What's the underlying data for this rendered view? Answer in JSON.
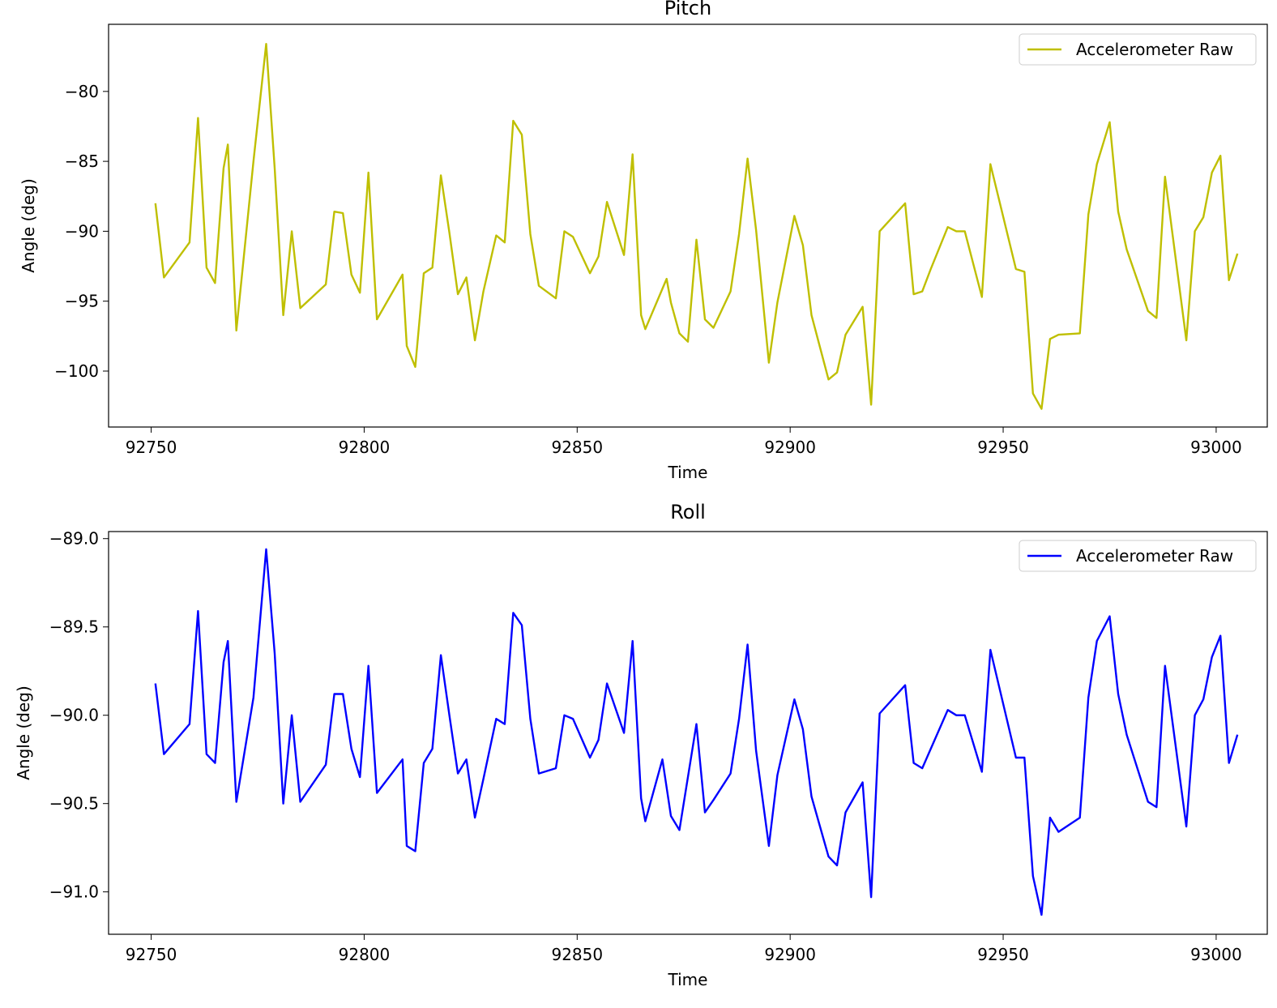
{
  "chart_data": [
    {
      "type": "line",
      "title": "Pitch",
      "xlabel": "Time",
      "ylabel": "Angle (deg)",
      "xlim": [
        92740,
        93012
      ],
      "ylim": [
        -104,
        -75.2
      ],
      "xticks": [
        92750,
        92800,
        92850,
        92900,
        92950,
        93000
      ],
      "yticks": [
        -100,
        -95,
        -90,
        -85,
        -80
      ],
      "ytick_labels": [
        "−100",
        "−95",
        "−90",
        "−85",
        "−80"
      ],
      "legend_position": "upper right",
      "grid": false,
      "series": [
        {
          "name": "Accelerometer Raw",
          "color": "#bfbf00",
          "x": [
            92751,
            92753,
            92759,
            92761,
            92763,
            92765,
            92767,
            92768,
            92770,
            92774,
            92777,
            92779,
            92781,
            92783,
            92785,
            92791,
            92793,
            92795,
            92797,
            92799,
            92801,
            92803,
            92809,
            92810,
            92812,
            92814,
            92816,
            92818,
            92820,
            92822,
            92824,
            92826,
            92828,
            92831,
            92833,
            92835,
            92837,
            92839,
            92841,
            92845,
            92847,
            92849,
            92853,
            92855,
            92857,
            92861,
            92863,
            92865,
            92866,
            92871,
            92872,
            92874,
            92876,
            92878,
            92880,
            92882,
            92886,
            92888,
            92890,
            92892,
            92895,
            92897,
            92901,
            92903,
            92905,
            92909,
            92911,
            92913,
            92917,
            92919,
            92921,
            92927,
            92929,
            92931,
            92933,
            92937,
            92939,
            92941,
            92945,
            92947,
            92953,
            92955,
            92957,
            92959,
            92961,
            92963,
            92968,
            92970,
            92972,
            92975,
            92977,
            92979,
            92984,
            92986,
            92988,
            92993,
            92995,
            92997,
            92999,
            93001,
            93003,
            93005
          ],
          "y": [
            -88,
            -93.3,
            -90.8,
            -81.9,
            -92.6,
            -93.7,
            -85.5,
            -83.8,
            -97.1,
            -85,
            -76.6,
            -85.5,
            -96,
            -90,
            -95.5,
            -93.8,
            -88.6,
            -88.7,
            -93.1,
            -94.4,
            -85.8,
            -96.3,
            -93.1,
            -98.2,
            -99.7,
            -93,
            -92.6,
            -86,
            -90.1,
            -94.5,
            -93.3,
            -97.8,
            -94.3,
            -90.3,
            -90.8,
            -82.1,
            -83.1,
            -90.2,
            -93.9,
            -94.8,
            -90,
            -90.4,
            -93,
            -91.8,
            -87.9,
            -91.7,
            -84.5,
            -96,
            -97,
            -93.4,
            -95.1,
            -97.3,
            -97.9,
            -90.6,
            -96.3,
            -96.9,
            -94.3,
            -90.2,
            -84.8,
            -89.9,
            -99.4,
            -95.1,
            -88.9,
            -91,
            -96,
            -100.6,
            -100.1,
            -97.4,
            -95.4,
            -102.4,
            -90,
            -88,
            -94.5,
            -94.3,
            -92.7,
            -89.7,
            -90,
            -90,
            -94.7,
            -85.2,
            -92.7,
            -92.9,
            -101.6,
            -102.7,
            -97.7,
            -97.4,
            -97.3,
            -88.8,
            -85.2,
            -82.2,
            -88.6,
            -91.3,
            -95.7,
            -96.2,
            -86.1,
            -97.8,
            -90,
            -89,
            -85.8,
            -84.6,
            -93.5,
            -91.6
          ]
        }
      ]
    },
    {
      "type": "line",
      "title": "Roll",
      "xlabel": "Time",
      "ylabel": "Angle (deg)",
      "xlim": [
        92740,
        93012
      ],
      "ylim": [
        -91.24,
        -88.96
      ],
      "xticks": [
        92750,
        92800,
        92850,
        92900,
        92950,
        93000
      ],
      "yticks": [
        -91.0,
        -90.5,
        -90.0,
        -89.5,
        -89.0
      ],
      "ytick_labels": [
        "−91.0",
        "−90.5",
        "−90.0",
        "−89.5",
        "−89.0"
      ],
      "legend_position": "upper right",
      "grid": false,
      "series": [
        {
          "name": "Accelerometer Raw",
          "color": "#0000ff",
          "x": [
            92751,
            92753,
            92759,
            92761,
            92763,
            92765,
            92767,
            92768,
            92770,
            92774,
            92777,
            92779,
            92781,
            92783,
            92785,
            92791,
            92793,
            92795,
            92797,
            92799,
            92801,
            92803,
            92809,
            92810,
            92812,
            92814,
            92816,
            92818,
            92820,
            92822,
            92824,
            92826,
            92828,
            92831,
            92833,
            92835,
            92837,
            92839,
            92841,
            92845,
            92847,
            92849,
            92853,
            92855,
            92857,
            92861,
            92863,
            92865,
            92866,
            92870,
            92872,
            92874,
            92878,
            92880,
            92882,
            92886,
            92888,
            92890,
            92892,
            92895,
            92897,
            92901,
            92903,
            92905,
            92909,
            92911,
            92913,
            92917,
            92919,
            92921,
            92927,
            92929,
            92931,
            92933,
            92937,
            92939,
            92941,
            92945,
            92947,
            92953,
            92955,
            92957,
            92959,
            92961,
            92963,
            92968,
            92970,
            92972,
            92975,
            92977,
            92979,
            92984,
            92986,
            92988,
            92993,
            92995,
            92997,
            92999,
            93001,
            93003,
            93005
          ],
          "y": [
            -89.82,
            -90.22,
            -90.05,
            -89.41,
            -90.22,
            -90.27,
            -89.7,
            -89.58,
            -90.49,
            -89.9,
            -89.06,
            -89.65,
            -90.5,
            -90,
            -90.49,
            -90.28,
            -89.88,
            -89.88,
            -90.19,
            -90.35,
            -89.72,
            -90.44,
            -90.25,
            -90.74,
            -90.77,
            -90.27,
            -90.19,
            -89.66,
            -90,
            -90.33,
            -90.25,
            -90.58,
            -90.36,
            -90.02,
            -90.05,
            -89.42,
            -89.49,
            -90.02,
            -90.33,
            -90.3,
            -90,
            -90.02,
            -90.24,
            -90.14,
            -89.82,
            -90.1,
            -89.58,
            -90.47,
            -90.6,
            -90.25,
            -90.57,
            -90.65,
            -90.05,
            -90.55,
            -90.48,
            -90.33,
            -90.02,
            -89.6,
            -90.2,
            -90.74,
            -90.34,
            -89.91,
            -90.08,
            -90.46,
            -90.8,
            -90.85,
            -90.55,
            -90.38,
            -91.03,
            -89.99,
            -89.83,
            -90.27,
            -90.3,
            -90.19,
            -89.97,
            -90,
            -90,
            -90.32,
            -89.63,
            -90.24,
            -90.24,
            -90.91,
            -91.13,
            -90.58,
            -90.66,
            -90.58,
            -89.9,
            -89.58,
            -89.44,
            -89.88,
            -90.11,
            -90.49,
            -90.52,
            -89.72,
            -90.63,
            -90,
            -89.91,
            -89.67,
            -89.55,
            -90.27,
            -90.11
          ]
        }
      ]
    }
  ]
}
